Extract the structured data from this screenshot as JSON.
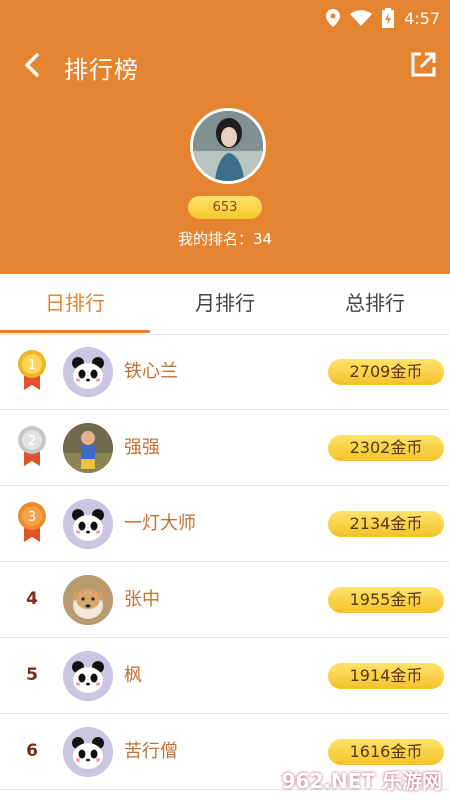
{
  "status": {
    "time": "4:57"
  },
  "header": {
    "title": "排行榜",
    "score": "653",
    "my_rank": "我的排名：34"
  },
  "tabs": [
    "日排行",
    "月排行",
    "总排行"
  ],
  "rows": [
    {
      "rank": "1",
      "name": "铁心兰",
      "coins": "2709金币",
      "avatar": "panda"
    },
    {
      "rank": "2",
      "name": "强强",
      "coins": "2302金币",
      "avatar": "photo-child"
    },
    {
      "rank": "3",
      "name": "一灯大师",
      "coins": "2134金币",
      "avatar": "panda"
    },
    {
      "rank": "4",
      "name": "张中",
      "coins": "1955金币",
      "avatar": "photo-dog"
    },
    {
      "rank": "5",
      "name": "枫",
      "coins": "1914金币",
      "avatar": "panda"
    },
    {
      "rank": "6",
      "name": "苦行僧",
      "coins": "1616金币",
      "avatar": "panda"
    }
  ],
  "watermark": "962.NET 乐游网",
  "colors": {
    "accent": "#E58430",
    "name_text": "#C27033",
    "rank_text": "#7a2c1d"
  }
}
